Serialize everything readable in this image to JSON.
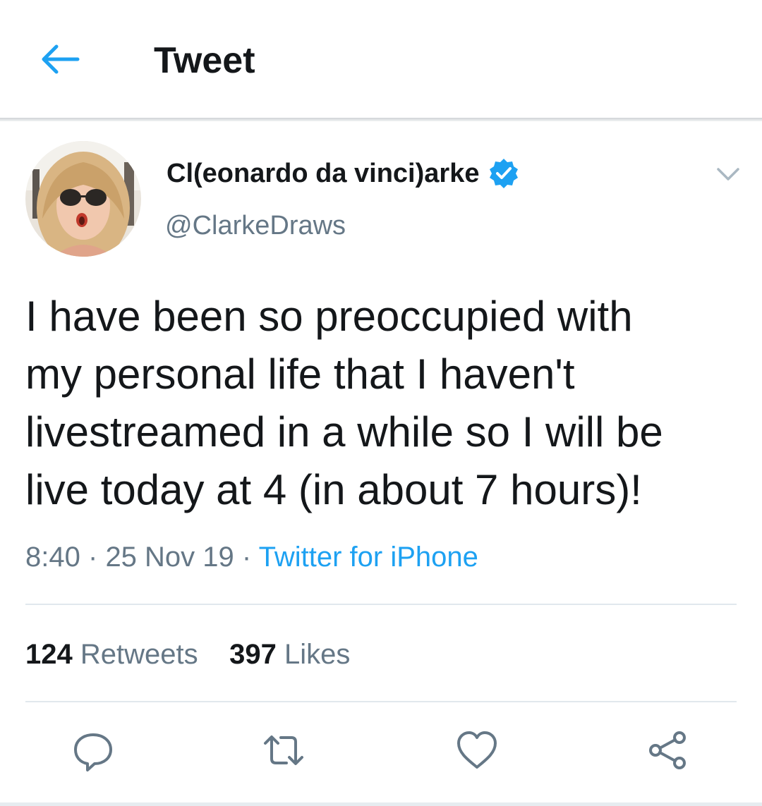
{
  "header": {
    "title": "Tweet",
    "back_icon": "back-arrow-icon"
  },
  "author": {
    "display_name": "Cl(eonardo da vinci)arke",
    "handle": "@ClarkeDraws",
    "verified": true
  },
  "tweet": {
    "text": "I have been so preoccupied with\nmy personal life that I haven't\nlivestreamed in a while so I will be\nlive today at 4 (in about 7 hours)!",
    "time": "8:40",
    "separator": "·",
    "date": "25 Nov 19",
    "source": "Twitter for iPhone"
  },
  "stats": {
    "retweets_count": "124",
    "retweets_label": "Retweets",
    "likes_count": "397",
    "likes_label": "Likes"
  },
  "actions": [
    "reply-icon",
    "retweet-icon",
    "like-icon",
    "share-icon"
  ],
  "colors": {
    "accent": "#1da1f2",
    "secondary_text": "#657786",
    "primary_text": "#14171a",
    "divider": "#e1e8ed"
  }
}
